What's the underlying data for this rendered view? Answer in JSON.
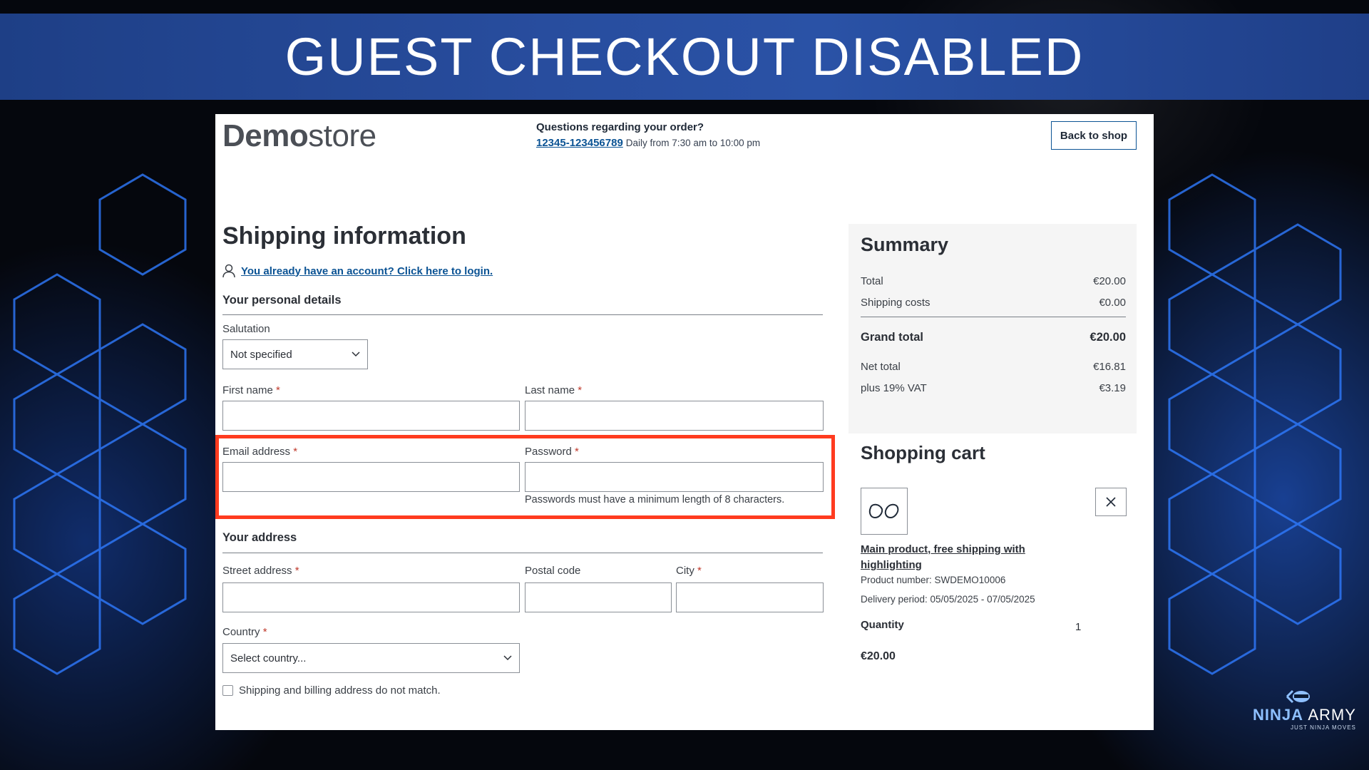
{
  "banner": {
    "title": "GUEST CHECKOUT DISABLED"
  },
  "header": {
    "logo_bold": "Demo",
    "logo_light": "store",
    "question": "Questions regarding your order?",
    "phone": "12345-123456789",
    "hours": "Daily from 7:30 am to 10:00 pm",
    "back_button": "Back to shop"
  },
  "form": {
    "title": "Shipping information",
    "login_link": "You already have an account? Click here to login.",
    "personal_heading": "Your personal details",
    "salutation_label": "Salutation",
    "salutation_value": "Not specified",
    "first_name_label": "First name",
    "last_name_label": "Last name",
    "email_label": "Email address",
    "password_label": "Password",
    "password_hint": "Passwords must have a minimum length of 8 characters.",
    "address_heading": "Your address",
    "street_label": "Street address",
    "postal_label": "Postal code",
    "city_label": "City",
    "country_label": "Country",
    "country_value": "Select country...",
    "different_billing": "Shipping and billing address do not match.",
    "required_mark": "*"
  },
  "summary": {
    "title": "Summary",
    "total_label": "Total",
    "total_value": "€20.00",
    "shipping_label": "Shipping costs",
    "shipping_value": "€0.00",
    "grand_label": "Grand total",
    "grand_value": "€20.00",
    "net_label": "Net total",
    "net_value": "€16.81",
    "vat_label": "plus 19% VAT",
    "vat_value": "€3.19"
  },
  "cart": {
    "title": "Shopping cart",
    "product_name": "Main product, free shipping with highlighting",
    "product_number": "Product number: SWDEMO10006",
    "delivery": "Delivery period: 05/05/2025 - 07/05/2025",
    "quantity_label": "Quantity",
    "quantity_value": "1",
    "price": "€20.00"
  },
  "watermark": {
    "brand_a": "NINJA",
    "brand_b": "ARMY",
    "tagline": "JUST NINJA MOVES"
  },
  "colors": {
    "banner": "#284d9e",
    "highlight": "#ff3b1f",
    "link": "#0b5394"
  }
}
